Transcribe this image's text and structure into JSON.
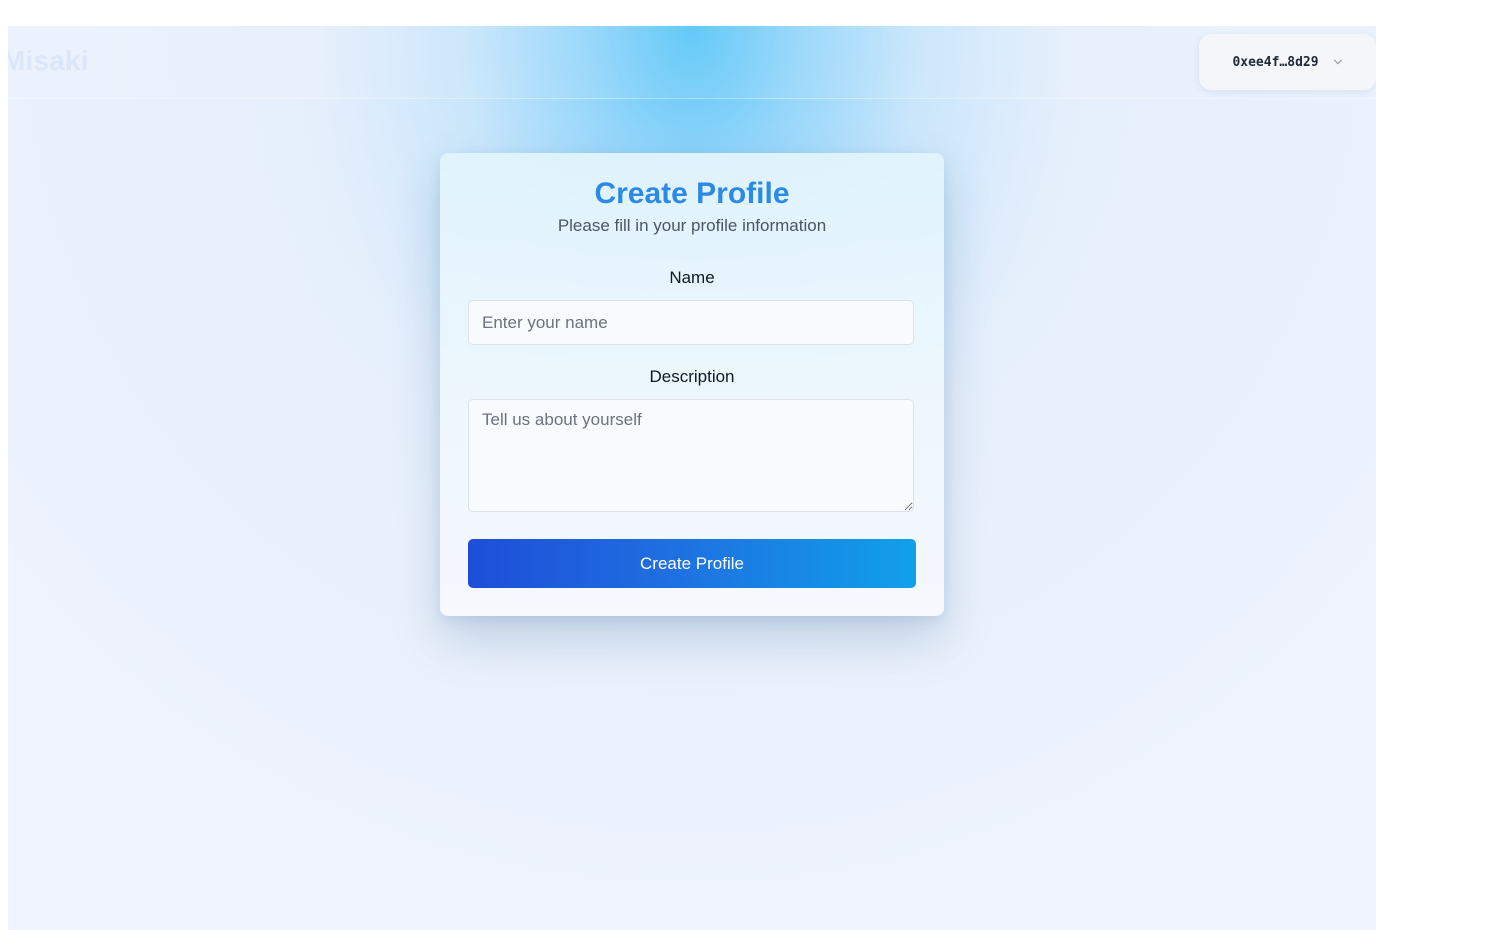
{
  "header": {
    "brand": "Misaki",
    "wallet": {
      "address": "0xee4f…8d29",
      "chevron_icon": "chevron-down-icon"
    }
  },
  "profile_form": {
    "title": "Create Profile",
    "subtitle": "Please fill in your profile information",
    "name": {
      "label": "Name",
      "value": "",
      "placeholder": "Enter your name"
    },
    "description": {
      "label": "Description",
      "value": "",
      "placeholder": "Tell us about yourself"
    },
    "submit_label": "Create Profile"
  },
  "colors": {
    "title": "#2b8ae6",
    "button_gradient_start": "#1d4ed8",
    "button_gradient_end": "#10a0ea",
    "glow": "#4fc3f7"
  }
}
